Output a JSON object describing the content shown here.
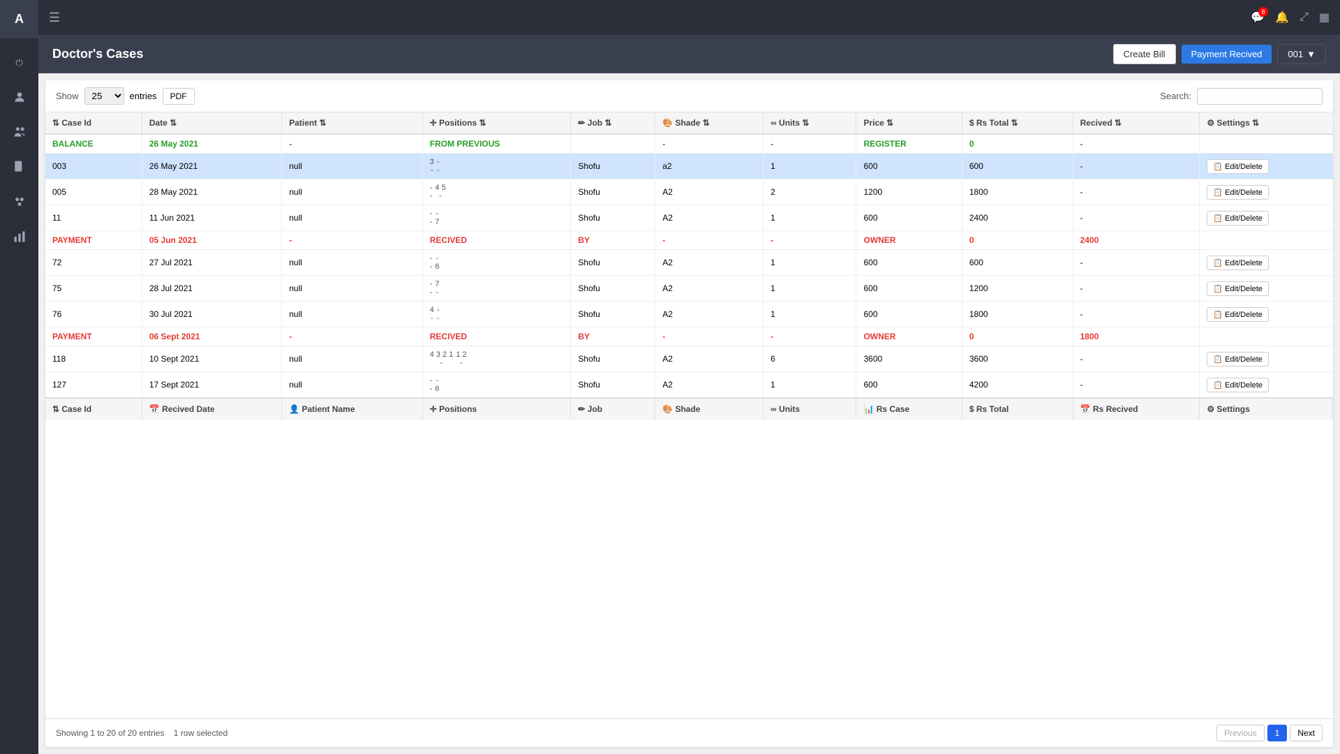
{
  "app": {
    "logo": "A",
    "sidebar_items": [
      {
        "name": "power-icon",
        "symbol": "⏻"
      },
      {
        "name": "user-circle-icon",
        "symbol": "👤"
      },
      {
        "name": "users-icon",
        "symbol": "👥"
      },
      {
        "name": "file-icon",
        "symbol": "📄"
      },
      {
        "name": "group-icon",
        "symbol": "👥"
      },
      {
        "name": "chart-icon",
        "symbol": "📊"
      }
    ]
  },
  "topbar": {
    "hamburger": "☰",
    "icons": [
      {
        "name": "chat-icon",
        "symbol": "💬",
        "badge": "8"
      },
      {
        "name": "bell-icon",
        "symbol": "🔔",
        "badge": ""
      },
      {
        "name": "expand-icon",
        "symbol": "⤢"
      },
      {
        "name": "grid-icon",
        "symbol": "▦"
      }
    ]
  },
  "page": {
    "title": "Doctor's Cases",
    "btn_create_bill": "Create Bill",
    "btn_payment": "Payment Recived",
    "btn_code": "001",
    "btn_code_arrow": "▼"
  },
  "table_controls": {
    "show_label": "Show",
    "show_value": "25",
    "entries_label": "entries",
    "pdf_label": "PDF",
    "search_label": "Search:",
    "search_placeholder": ""
  },
  "table": {
    "headers": [
      "Case Id",
      "Date",
      "Patient",
      "Positions",
      "Job",
      "Shade",
      "Units",
      "Price",
      "Rs Total",
      "Recived",
      "Settings"
    ],
    "footer_headers": [
      "Case Id",
      "Recived Date",
      "Patient Name",
      "Positions",
      "Job",
      "Shade",
      "Units",
      "Rs Case",
      "Rs Total",
      "Rs Recived",
      "Settings"
    ],
    "rows": [
      {
        "type": "balance",
        "case_id": "BALANCE",
        "date": "26 May 2021",
        "patient": "-",
        "positions_a": "",
        "positions_b": "",
        "job": "",
        "shade": "-",
        "units": "-",
        "price": "",
        "price_label": "REGISTER",
        "rs_total": "0",
        "recived": "-",
        "from_previous": "FROM PREVIOUS",
        "selected": false
      },
      {
        "type": "normal",
        "case_id": "003",
        "date": "26 May 2021",
        "patient": "null",
        "positions_a": "3",
        "positions_a2": "-",
        "positions_b": "-",
        "positions_b2": "-",
        "job": "Shofu",
        "shade": "a2",
        "units": "1",
        "price": "600",
        "rs_total": "600",
        "recived": "-",
        "selected": true
      },
      {
        "type": "normal",
        "case_id": "005",
        "date": "28 May 2021",
        "patient": "null",
        "positions_a": "-",
        "positions_a2": "-",
        "positions_b": "4 5",
        "positions_b2": "-",
        "job": "Shofu",
        "shade": "A2",
        "units": "2",
        "price": "1200",
        "rs_total": "1800",
        "recived": "-",
        "selected": false
      },
      {
        "type": "normal",
        "case_id": "11",
        "date": "11 Jun 2021",
        "patient": "null",
        "positions_a": "-",
        "positions_a2": "-",
        "positions_b": "",
        "positions_b2": "7",
        "job": "Shofu",
        "shade": "A2",
        "units": "1",
        "price": "600",
        "rs_total": "2400",
        "recived": "-",
        "selected": false
      },
      {
        "type": "payment",
        "case_id": "PAYMENT",
        "date": "05 Jun 2021",
        "patient": "-",
        "positions_a": "RECIVED",
        "job": "BY",
        "shade": "-",
        "units": "-",
        "price": "OWNER",
        "rs_total": "0",
        "recived": "2400",
        "selected": false
      },
      {
        "type": "normal",
        "case_id": "72",
        "date": "27 Jul 2021",
        "patient": "null",
        "positions_a": "-",
        "positions_a2": "-",
        "positions_b": "",
        "positions_b2": "6",
        "job": "Shofu",
        "shade": "A2",
        "units": "1",
        "price": "600",
        "rs_total": "600",
        "recived": "-",
        "selected": false
      },
      {
        "type": "normal",
        "case_id": "75",
        "date": "28 Jul 2021",
        "patient": "null",
        "positions_a": "-",
        "positions_a2": "-",
        "positions_b": "7",
        "positions_b2": "-",
        "job": "Shofu",
        "shade": "A2",
        "units": "1",
        "price": "600",
        "rs_total": "1200",
        "recived": "-",
        "selected": false
      },
      {
        "type": "normal",
        "case_id": "76",
        "date": "30 Jul 2021",
        "patient": "null",
        "positions_a": "4",
        "positions_a2": "-",
        "positions_b": "-",
        "positions_b2": "",
        "job": "Shofu",
        "shade": "A2",
        "units": "1",
        "price": "600",
        "rs_total": "1800",
        "recived": "-",
        "selected": false
      },
      {
        "type": "payment",
        "case_id": "PAYMENT",
        "date": "06 Sept 2021",
        "patient": "-",
        "positions_a": "RECIVED",
        "job": "BY",
        "shade": "-",
        "units": "-",
        "price": "OWNER",
        "rs_total": "0",
        "recived": "1800",
        "selected": false
      },
      {
        "type": "normal",
        "case_id": "118",
        "date": "10 Sept 2021",
        "patient": "null",
        "positions_a": "4 3 2 1",
        "positions_a2": "-",
        "positions_b": "1 2",
        "positions_b2": "-",
        "job": "Shofu",
        "shade": "A2",
        "units": "6",
        "price": "3600",
        "rs_total": "3600",
        "recived": "-",
        "selected": false
      },
      {
        "type": "normal",
        "case_id": "127",
        "date": "17 Sept 2021",
        "patient": "null",
        "positions_a": "-",
        "positions_a2": "-",
        "positions_b": "",
        "positions_b2": "6",
        "job": "Shofu",
        "shade": "A2",
        "units": "1",
        "price": "600",
        "rs_total": "4200",
        "recived": "-",
        "selected": false
      }
    ]
  },
  "pagination": {
    "showing": "Showing 1 to 20 of 20 entries",
    "row_selected": "1 row selected",
    "previous": "Previous",
    "next": "Next",
    "current_page": "1"
  }
}
